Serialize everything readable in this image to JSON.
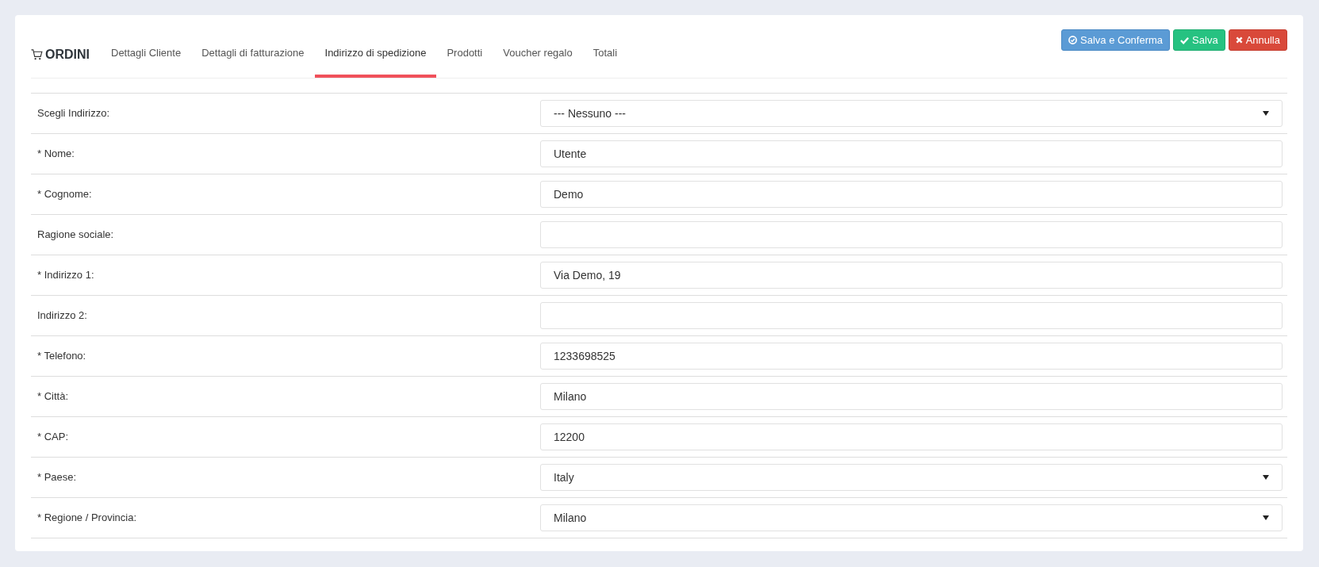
{
  "header": {
    "title": "ORDINI"
  },
  "tabs": [
    {
      "label": "Dettagli Cliente",
      "selected": false
    },
    {
      "label": "Dettagli di fatturazione",
      "selected": false
    },
    {
      "label": "Indirizzo di spedizione",
      "selected": true
    },
    {
      "label": "Prodotti",
      "selected": false
    },
    {
      "label": "Voucher regalo",
      "selected": false
    },
    {
      "label": "Totali",
      "selected": false
    }
  ],
  "buttons": [
    {
      "label": "Salva e Conferma",
      "kind": "confirm"
    },
    {
      "label": "Salva",
      "kind": "save"
    },
    {
      "label": "Annulla",
      "kind": "cancel"
    }
  ],
  "fields": [
    {
      "label": "Scegli Indirizzo:",
      "kind": "select",
      "value": "--- Nessuno ---"
    },
    {
      "label": "* Nome:",
      "kind": "input",
      "value": "Utente"
    },
    {
      "label": "* Cognome:",
      "kind": "input",
      "value": "Demo"
    },
    {
      "label": "Ragione sociale:",
      "kind": "input"
    },
    {
      "label": "* Indirizzo 1:",
      "kind": "input",
      "value": "Via Demo, 19"
    },
    {
      "label": "Indirizzo 2:",
      "kind": "input"
    },
    {
      "label": "* Telefono:",
      "kind": "input",
      "value": "1233698525"
    },
    {
      "label": "* Città:",
      "kind": "input",
      "value": "Milano"
    },
    {
      "label": "* CAP:",
      "kind": "input",
      "value": "12200"
    },
    {
      "label": "* Paese:",
      "kind": "select",
      "value": "Italy"
    },
    {
      "label": "* Regione / Provincia:",
      "kind": "select",
      "value": "Milano"
    }
  ]
}
